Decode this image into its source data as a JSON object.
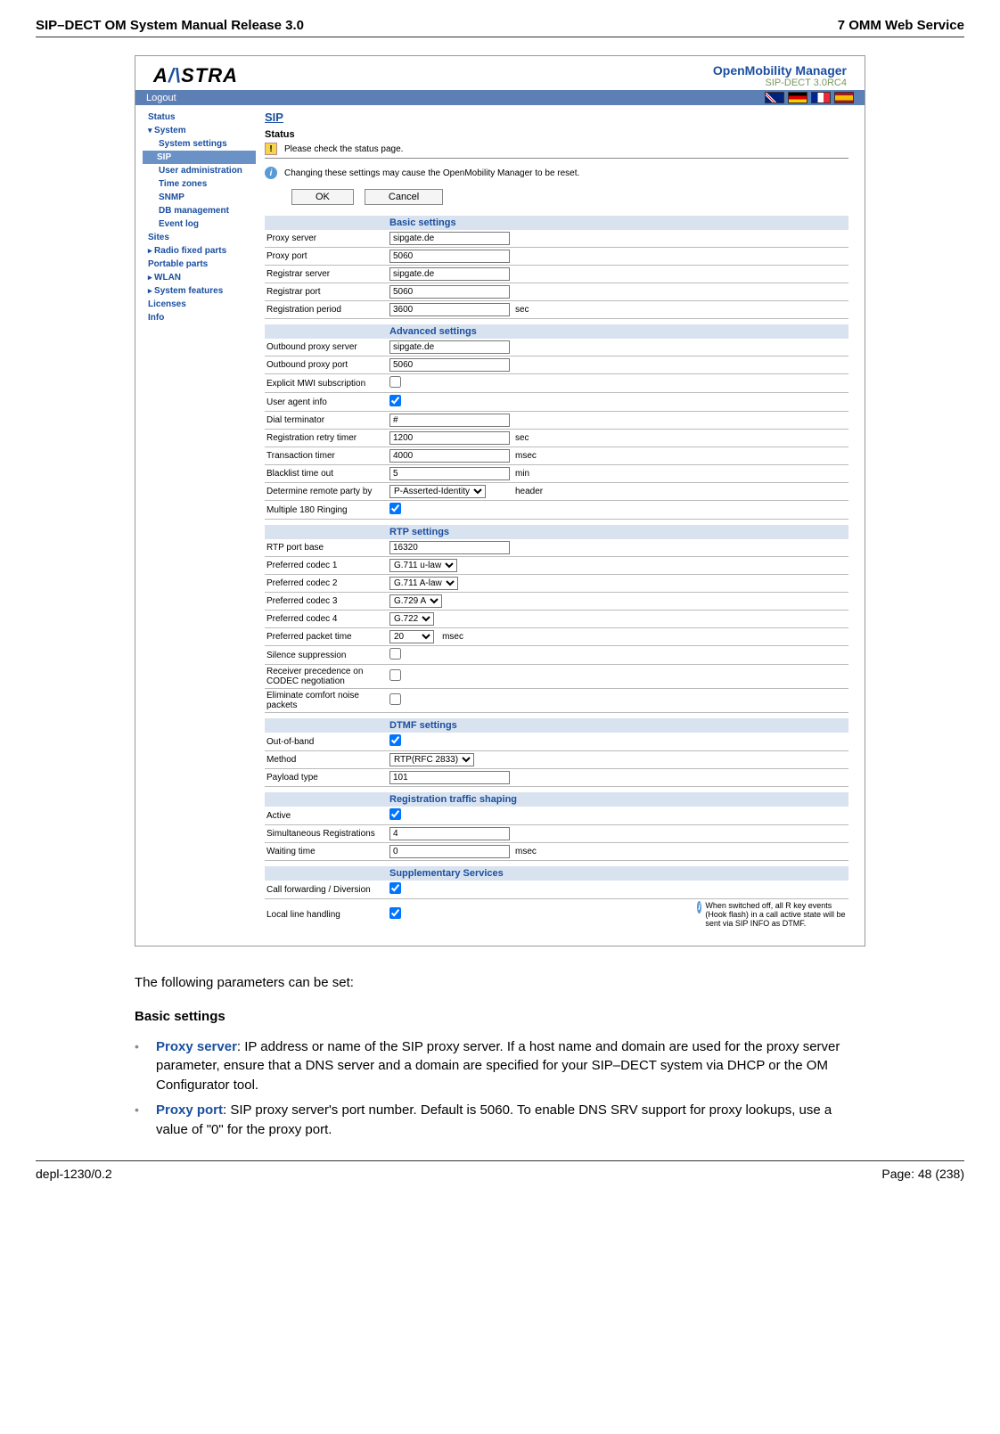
{
  "doc": {
    "header_left": "SIP–DECT OM System Manual Release 3.0",
    "header_right": "7 OMM Web Service",
    "footer_left": "depl-1230/0.2",
    "footer_right": "Page: 48 (238)"
  },
  "logo_text": "A   STRA",
  "product": {
    "line1": "OpenMobility Manager",
    "line2": "SIP-DECT 3.0RC4"
  },
  "topbar": {
    "logout": "Logout"
  },
  "sidebar": {
    "items": [
      {
        "label": "Status",
        "cls": "item"
      },
      {
        "label": "System",
        "cls": "item caretd"
      },
      {
        "label": "System settings",
        "cls": "item sub"
      },
      {
        "label": "SIP",
        "cls": "item sub active"
      },
      {
        "label": "User administration",
        "cls": "item sub"
      },
      {
        "label": "Time zones",
        "cls": "item sub"
      },
      {
        "label": "SNMP",
        "cls": "item sub"
      },
      {
        "label": "DB management",
        "cls": "item sub"
      },
      {
        "label": "Event log",
        "cls": "item sub"
      },
      {
        "label": "Sites",
        "cls": "item"
      },
      {
        "label": "Radio fixed parts",
        "cls": "item caret"
      },
      {
        "label": "Portable parts",
        "cls": "item"
      },
      {
        "label": "WLAN",
        "cls": "item caret"
      },
      {
        "label": "System features",
        "cls": "item caret"
      },
      {
        "label": "Licenses",
        "cls": "item"
      },
      {
        "label": "Info",
        "cls": "item"
      }
    ]
  },
  "content": {
    "page_title": "SIP",
    "status_title": "Status",
    "warn": "Please check the status page.",
    "info": "Changing these settings may cause the OpenMobility Manager to be reset.",
    "ok": "OK",
    "cancel": "Cancel"
  },
  "sections": {
    "basic": {
      "title": "Basic settings",
      "proxy_server": {
        "label": "Proxy server",
        "value": "sipgate.de"
      },
      "proxy_port": {
        "label": "Proxy port",
        "value": "5060"
      },
      "registrar_server": {
        "label": "Registrar server",
        "value": "sipgate.de"
      },
      "registrar_port": {
        "label": "Registrar port",
        "value": "5060"
      },
      "registration_period": {
        "label": "Registration period",
        "value": "3600",
        "unit": "sec"
      }
    },
    "advanced": {
      "title": "Advanced settings",
      "ob_proxy_server": {
        "label": "Outbound proxy server",
        "value": "sipgate.de"
      },
      "ob_proxy_port": {
        "label": "Outbound proxy port",
        "value": "5060"
      },
      "explicit_mwi": {
        "label": "Explicit MWI subscription",
        "checked": false
      },
      "user_agent": {
        "label": "User agent info",
        "checked": true
      },
      "dial_term": {
        "label": "Dial terminator",
        "value": "#"
      },
      "reg_retry": {
        "label": "Registration retry timer",
        "value": "1200",
        "unit": "sec"
      },
      "transaction": {
        "label": "Transaction timer",
        "value": "4000",
        "unit": "msec"
      },
      "blacklist": {
        "label": "Blacklist time out",
        "value": "5",
        "unit": "min"
      },
      "remote_party": {
        "label": "Determine remote party by",
        "value": "P-Asserted-Identity",
        "unit": "header"
      },
      "multiple_180": {
        "label": "Multiple 180 Ringing",
        "checked": true
      }
    },
    "rtp": {
      "title": "RTP settings",
      "port_base": {
        "label": "RTP port base",
        "value": "16320"
      },
      "codec1": {
        "label": "Preferred codec 1",
        "value": "G.711 u-law"
      },
      "codec2": {
        "label": "Preferred codec 2",
        "value": "G.711 A-law"
      },
      "codec3": {
        "label": "Preferred codec 3",
        "value": "G.729 A"
      },
      "codec4": {
        "label": "Preferred codec 4",
        "value": "G.722"
      },
      "packet_time": {
        "label": "Preferred packet time",
        "value": "20",
        "unit": "msec"
      },
      "silence": {
        "label": "Silence suppression",
        "checked": false
      },
      "recv_prec": {
        "label": "Receiver precedence on CODEC negotiation",
        "checked": false
      },
      "elim_comfort": {
        "label": "Eliminate comfort noise packets",
        "checked": false
      }
    },
    "dtmf": {
      "title": "DTMF settings",
      "oob": {
        "label": "Out-of-band",
        "checked": true
      },
      "method": {
        "label": "Method",
        "value": "RTP(RFC 2833)"
      },
      "payload": {
        "label": "Payload type",
        "value": "101"
      }
    },
    "regshape": {
      "title": "Registration traffic shaping",
      "active": {
        "label": "Active",
        "checked": true
      },
      "simul": {
        "label": "Simultaneous Registrations",
        "value": "4"
      },
      "wait": {
        "label": "Waiting time",
        "value": "0",
        "unit": "msec"
      }
    },
    "supp": {
      "title": "Supplementary Services",
      "callfwd": {
        "label": "Call forwarding / Diversion",
        "checked": true
      },
      "local_line": {
        "label": "Local line handling",
        "checked": true,
        "note": "When switched off, all R key events (Hook flash) in a call active state will be sent via SIP INFO as DTMF."
      }
    }
  },
  "body": {
    "intro": "The following parameters can be set:",
    "basic_heading": "Basic settings",
    "bullets": [
      {
        "term": "Proxy server",
        "text": ": IP address or name of the SIP proxy server. If a host name and domain are used for the proxy server parameter, ensure that a DNS server and a domain are specified for your SIP–DECT system via DHCP or the OM Configurator tool."
      },
      {
        "term": "Proxy port",
        "text": ": SIP proxy server's port number. Default is 5060. To enable DNS SRV support for proxy lookups, use a value of \"0\" for the proxy port."
      }
    ]
  }
}
